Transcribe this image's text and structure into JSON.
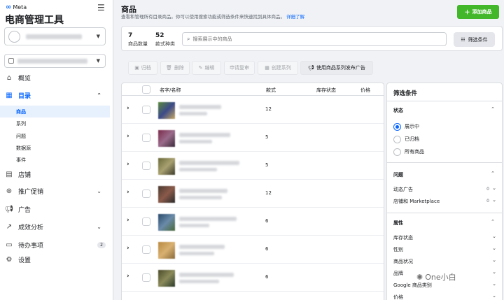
{
  "brand": {
    "logo_text": "Meta",
    "app_title": "电商管理工具"
  },
  "sidebar": {
    "menu_icon": "hamburger-icon",
    "nav": [
      {
        "label": "概览",
        "icon": "home-icon"
      },
      {
        "label": "目录",
        "icon": "grid-icon",
        "expanded": true
      },
      {
        "label": "店铺",
        "icon": "store-icon"
      },
      {
        "label": "推广促销",
        "icon": "promo-icon"
      },
      {
        "label": "广告",
        "icon": "megaphone-icon"
      },
      {
        "label": "成效分析",
        "icon": "chart-icon"
      },
      {
        "label": "待办事项",
        "icon": "todo-icon",
        "badge": "2"
      },
      {
        "label": "设置",
        "icon": "gear-icon"
      }
    ],
    "catalog_sub": [
      "商品",
      "系列",
      "问题",
      "数据源",
      "事件"
    ],
    "selected_sub": "商品"
  },
  "header": {
    "title": "商品",
    "description": "查看和管理所有目录商品。你可以使用搜索功能或筛选条件来快速找到具体商品。",
    "learn_more": "详细了解",
    "add_button": "添加商品"
  },
  "stats": {
    "items_count": "7",
    "items_label": "商品数量",
    "variants_count": "52",
    "variants_label": "款式种类"
  },
  "search": {
    "placeholder": "搜索展示中的商品",
    "value": ""
  },
  "filter_button": "筛选条件",
  "toolbar": {
    "archive": "归档",
    "delete": "删除",
    "edit": "编辑",
    "request_review": "申请复审",
    "create_set": "创建系列",
    "promote": "使用商品系列发布广告"
  },
  "table": {
    "columns": {
      "name": "名字/名称",
      "variants": "款式",
      "inventory": "库存状态",
      "price": "价格"
    },
    "rows": [
      {
        "variants": "12",
        "colors": [
          "#5b8a3a",
          "#3b4a8a",
          "#c8a860"
        ]
      },
      {
        "variants": "5",
        "colors": [
          "#7a2b4a",
          "#9a6a8a",
          "#3a2a3a"
        ]
      },
      {
        "variants": "5",
        "colors": [
          "#6a6a3a",
          "#a8a070",
          "#3a3a2a"
        ]
      },
      {
        "variants": "12",
        "colors": [
          "#4a3a30",
          "#8a5a4a",
          "#2a2a2a"
        ]
      },
      {
        "variants": "6",
        "colors": [
          "#2a4a6a",
          "#6a8aaa",
          "#4a6a3a"
        ]
      },
      {
        "variants": "6",
        "colors": [
          "#b88a40",
          "#d8b070",
          "#8a6a3a"
        ]
      },
      {
        "variants": "6",
        "colors": [
          "#4a4a2a",
          "#8a8a5a",
          "#2a3a2a"
        ]
      }
    ]
  },
  "filter_panel": {
    "title": "筛选条件",
    "status": {
      "label": "状态",
      "options": [
        "展示中",
        "已归档",
        "所有商品"
      ],
      "selected": "展示中"
    },
    "issues": {
      "label": "问题",
      "items": [
        {
          "label": "动态广告",
          "count": "0"
        },
        {
          "label": "店铺和 Marketplace",
          "count": "0"
        }
      ]
    },
    "attributes": {
      "label": "属性",
      "items": [
        "库存状态",
        "性别",
        "商品状况",
        "品牌",
        "Google 商品类别",
        "价格"
      ]
    }
  },
  "watermark": {
    "text": "One小白"
  },
  "accent_color": "#0866ff",
  "add_button_color": "#42b72a"
}
